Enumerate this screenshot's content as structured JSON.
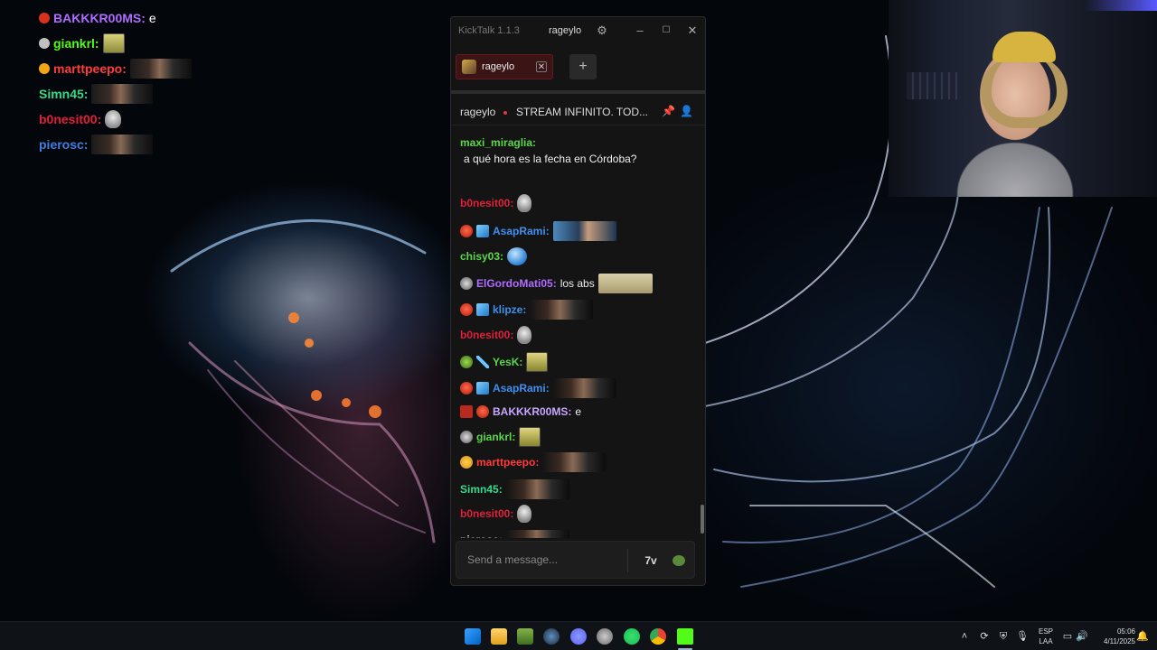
{
  "overlay_chat": [
    {
      "user": "BAKKKR00MS",
      "user_color": "#b06bff",
      "badge_color": "#d8321f",
      "text": "e",
      "emote": ""
    },
    {
      "user": "giankrl",
      "user_color": "#53fc18",
      "badge_color": "#c0c0c0",
      "text": "",
      "emote": "sponge"
    },
    {
      "user": "marttpeepo",
      "user_color": "#ff3b3b",
      "badge_color": "#f2a614",
      "text": "",
      "emote": "person"
    },
    {
      "user": "Simn45",
      "user_color": "#37d98a",
      "badge_color": "",
      "text": "",
      "emote": "person"
    },
    {
      "user": "b0nesit00",
      "user_color": "#e0203a",
      "badge_color": "",
      "text": "",
      "emote": "skull"
    },
    {
      "user": "pierosc",
      "user_color": "#3f7fe0",
      "badge_color": "",
      "text": "",
      "emote": "person"
    }
  ],
  "window": {
    "app_title": "KickTalk 1.1.3",
    "username": "rageylo",
    "settings_icon": "gear-icon",
    "minimize_icon": "minimize-icon",
    "maximize_icon": "maximize-icon",
    "close_icon": "close-icon"
  },
  "tabs": [
    {
      "label": "rageylo",
      "active": true
    }
  ],
  "add_tab_label": "+",
  "channel": {
    "name": "rageylo",
    "live": true,
    "title": "STREAM INFINITO. TOD...",
    "pin_icon": "pin-icon",
    "user_icon": "user-icon"
  },
  "messages": [
    {
      "user": "maxi_miraglia",
      "color": "#5cd64a",
      "badges": [],
      "text": "a qué hora es la fecha en Córdoba?",
      "emote": ""
    },
    {
      "user": "b0nesit00",
      "color": "#e0203a",
      "badges": [],
      "text": "",
      "emote": "skull"
    },
    {
      "user": "AsapRami",
      "color": "#3f8ff0",
      "badges": [
        "red",
        "cube"
      ],
      "text": "",
      "emote": "asap"
    },
    {
      "user": "chisy03",
      "color": "#5cd64a",
      "badges": [],
      "text": "",
      "emote": "globe"
    },
    {
      "user": "ElGordoMati05",
      "color": "#b06bff",
      "badges": [
        "skull"
      ],
      "text": "los abs",
      "emote": "abs"
    },
    {
      "user": "klipze",
      "color": "#3f8ff0",
      "badges": [
        "red",
        "cube"
      ],
      "text": "",
      "emote": "person"
    },
    {
      "user": "b0nesit00",
      "color": "#e0203a",
      "badges": [],
      "text": "",
      "emote": "skull"
    },
    {
      "user": "YesK",
      "color": "#5cd64a",
      "badges": [
        "green",
        "sword"
      ],
      "text": "",
      "emote": "sponge"
    },
    {
      "user": "AsapRami",
      "color": "#3f8ff0",
      "badges": [
        "red",
        "cube"
      ],
      "text": "",
      "emote": "person"
    },
    {
      "user": "BAKKKR00MS",
      "color": "#c7a6ff",
      "badges": [
        "7tv",
        "red"
      ],
      "text": "e",
      "emote": ""
    },
    {
      "user": "giankrl",
      "color": "#5cd64a",
      "badges": [
        "skull"
      ],
      "text": "",
      "emote": "sponge"
    },
    {
      "user": "marttpeepo",
      "color": "#ff3b3b",
      "badges": [
        "yellow"
      ],
      "text": "",
      "emote": "person"
    },
    {
      "user": "Simn45",
      "color": "#37d98a",
      "badges": [],
      "text": "",
      "emote": "person"
    },
    {
      "user": "b0nesit00",
      "color": "#e0203a",
      "badges": [],
      "text": "",
      "emote": "skull"
    },
    {
      "user": "pierosc",
      "color": "#dddddd",
      "badges": [],
      "text": "",
      "emote": "person"
    }
  ],
  "input": {
    "placeholder": "Send a message...",
    "emote_7tv_label": "7v",
    "emote_kick_icon": "kick-emote-icon"
  },
  "taskbar": {
    "apps": [
      "windows-start",
      "file-explorer",
      "image-viewer",
      "steam",
      "discord",
      "app",
      "spotify",
      "chrome",
      "kick"
    ],
    "lang_top": "ESP",
    "lang_bottom": "LAA",
    "time": "05:06",
    "date": "4/11/2025"
  }
}
